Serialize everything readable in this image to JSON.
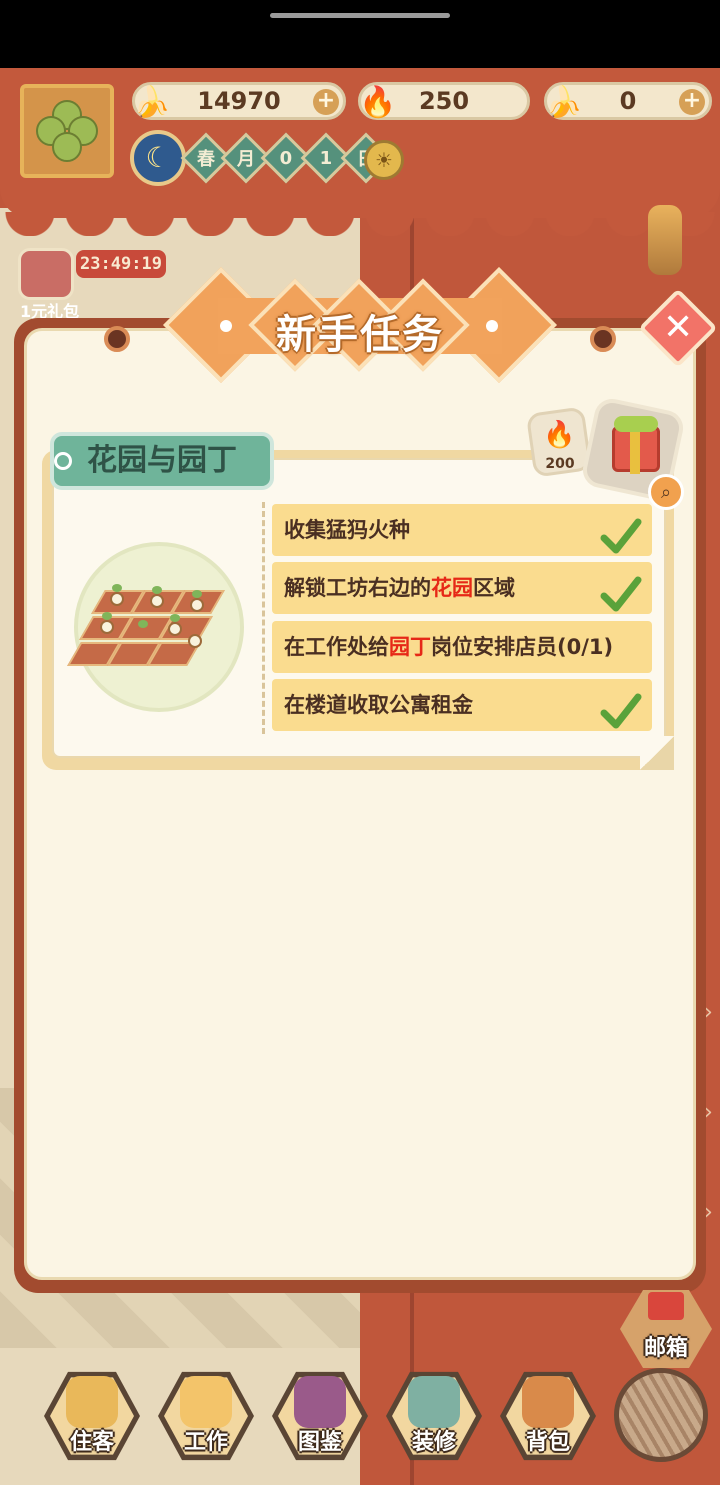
{
  "status_bar": {},
  "resources": {
    "banana": {
      "icon": "banana-icon",
      "value": "14970"
    },
    "fire": {
      "icon": "fire-seed-icon",
      "value": "250"
    },
    "moon": {
      "icon": "blue-moon-icon",
      "value": "0"
    }
  },
  "date": {
    "season": "春",
    "month": "月",
    "day_digit_1": "0",
    "day_digit_2": "1",
    "day_suffix": "日"
  },
  "event": {
    "timer": "23:49:19",
    "label": "1元礼包"
  },
  "modal": {
    "title": "新手任务",
    "task_group": {
      "name": "花园与园丁",
      "reward_amount": "200",
      "tasks": [
        {
          "text_before": "收集猛犸火种",
          "highlight": "",
          "text_after": "",
          "done": true
        },
        {
          "text_before": "解锁工坊右边的",
          "highlight": "花园",
          "text_after": "区域",
          "done": true
        },
        {
          "text_before": "在工作处给",
          "highlight": "园丁",
          "text_after": "岗位安排店员(0/1)",
          "done": false
        },
        {
          "text_before": "在楼道收取公寓租金",
          "highlight": "",
          "text_after": "",
          "done": true
        }
      ]
    }
  },
  "nav": {
    "mailbox": "邮箱",
    "items": [
      {
        "label": "住客",
        "icon": "guest-icon"
      },
      {
        "label": "工作",
        "icon": "work-cat-icon"
      },
      {
        "label": "图鉴",
        "icon": "book-icon"
      },
      {
        "label": "装修",
        "icon": "hammer-icon"
      },
      {
        "label": "背包",
        "icon": "backpack-icon"
      }
    ]
  },
  "colors": {
    "accent_orange": "#f2a35c",
    "highlight_red": "#e62817",
    "task_bg": "#fadc8f",
    "label_green": "#6fb49a",
    "check_green": "#5aa23a"
  }
}
